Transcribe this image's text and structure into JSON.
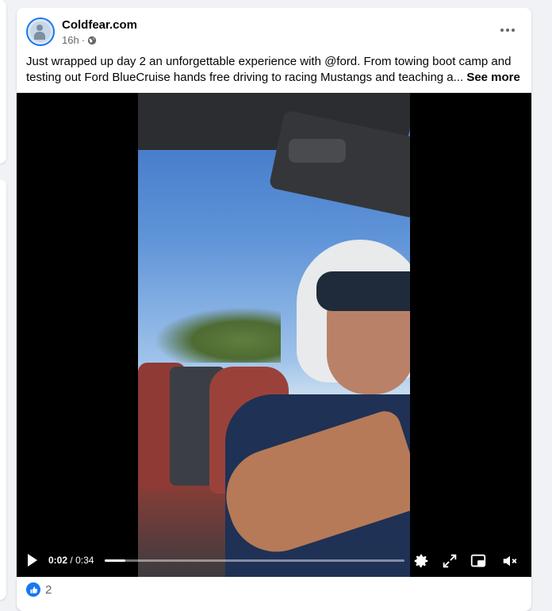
{
  "post": {
    "author": "Coldfear.com",
    "time": "16h",
    "dot": "·",
    "text": "Just wrapped up day 2 an unforgettable experience with @ford. From towing boot camp and testing out Ford BlueCruise hands free driving to racing Mustangs and teaching a...",
    "see_more": "See more"
  },
  "video": {
    "current_time": "0:02",
    "separator": "/",
    "duration": "0:34",
    "progress_fraction": 0.07
  },
  "icons": {
    "privacy": "globe-icon",
    "more": "more-options-icon",
    "play": "play-icon",
    "settings": "gear-icon",
    "fullscreen": "expand-icon",
    "pip": "picture-in-picture-icon",
    "mute": "muted-speaker-icon",
    "like": "thumbs-up-icon"
  },
  "reactions": {
    "count": "2"
  },
  "colors": {
    "accent": "#1877f2",
    "text": "#050505",
    "secondary": "#65676b"
  }
}
